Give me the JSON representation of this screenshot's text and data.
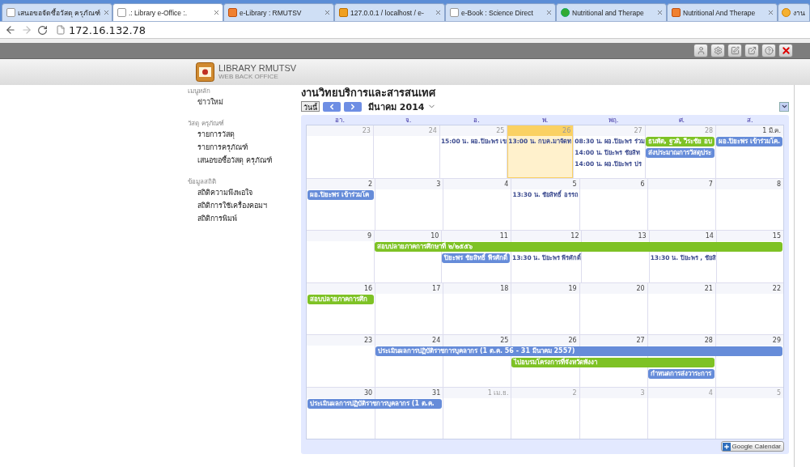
{
  "browser_tabs": [
    {
      "title": "เสนอขอจัดซื้อวัสดุ ครุภัณฑ์",
      "selected": false,
      "kind": "page"
    },
    {
      "title": ".: Library e-Office :.",
      "selected": true,
      "kind": "page"
    },
    {
      "title": "e-Library : RMUTSV",
      "selected": false,
      "kind": "orange"
    },
    {
      "title": "127.0.0.1 / localhost / e-",
      "selected": false,
      "kind": "pma"
    },
    {
      "title": "e-Book : Science Direct",
      "selected": false,
      "kind": "page"
    },
    {
      "title": "Nutritional and Therape",
      "selected": false,
      "kind": "green"
    },
    {
      "title": "Nutritional And Therape",
      "selected": false,
      "kind": "orange"
    },
    {
      "title": "งาน",
      "selected": false,
      "kind": "yellow"
    }
  ],
  "address_bar": {
    "url": "172.16.132.78"
  },
  "logo": {
    "title": "LIBRARY RMUTSV",
    "subtitle": "WEB BACK OFFICE"
  },
  "sidebar": [
    {
      "heading": "เมนูหลัก",
      "items": [
        "ข่าวใหม่"
      ]
    },
    {
      "heading": "วัสดุ ครุภัณฑ์",
      "items": [
        "รายการวัสดุ",
        "รายการครุภัณฑ์",
        "เสนอขอซื้อวัสดุ ครุภัณฑ์"
      ]
    },
    {
      "heading": "ข้อมูลสถิติ",
      "items": [
        "สถิติความพึงพอใจ",
        "สถิติการใช้เครื่องคอมฯ",
        "สถิติการพิมพ์"
      ]
    }
  ],
  "calendar": {
    "title": "งานวิทยบริการและสารสนเทศ",
    "today_button": "วันนี้",
    "month": "มีนาคม 2014",
    "weekdays": [
      "อา.",
      "จ.",
      "อ.",
      "พ.",
      "พฤ.",
      "ศ.",
      "ส."
    ],
    "weeks": [
      {
        "days": [
          {
            "label": "23",
            "other_month": true,
            "today": false
          },
          {
            "label": "24",
            "other_month": true,
            "today": false
          },
          {
            "label": "25",
            "other_month": true,
            "today": false
          },
          {
            "label": "26",
            "other_month": true,
            "today": true
          },
          {
            "label": "27",
            "other_month": true,
            "today": false
          },
          {
            "label": "28",
            "other_month": true,
            "today": false
          },
          {
            "label": "1 มี.ค.",
            "other_month": false,
            "today": false
          }
        ],
        "lanes": [
          [
            {
              "kind": "empty"
            },
            {
              "kind": "empty"
            },
            {
              "kind": "timed",
              "text": "15:00 น. ผอ.ปิยะพร เข"
            },
            {
              "kind": "timed",
              "text": "13:00 น. กบค.มาจัดท"
            },
            {
              "kind": "timed",
              "text": "08:30 น. ผอ.ปิยะพร ร่วม"
            },
            {
              "kind": "bar",
              "text": "ธนพัต, ฐวดิ, วีระชัย อบ",
              "color": "#7ec225"
            },
            {
              "kind": "bar",
              "text": "ผอ.ปิยะพร เข้าร่วมโค.",
              "color": "#668cd9"
            }
          ],
          [
            {
              "kind": "empty"
            },
            {
              "kind": "empty"
            },
            {
              "kind": "empty"
            },
            {
              "kind": "empty"
            },
            {
              "kind": "timed",
              "text": "14:00 น. ปิยะพร ชัยสิท"
            },
            {
              "kind": "bar",
              "text": "ส่งประมาณการวัสดุประ",
              "color": "#668cd9"
            },
            {
              "kind": "empty"
            }
          ],
          [
            {
              "kind": "empty"
            },
            {
              "kind": "empty"
            },
            {
              "kind": "empty"
            },
            {
              "kind": "empty"
            },
            {
              "kind": "timed",
              "text": "14:00 น. ผอ.ปิยะพร ปร"
            },
            {
              "kind": "empty"
            },
            {
              "kind": "empty"
            }
          ]
        ]
      },
      {
        "days": [
          {
            "label": "2",
            "other_month": false,
            "today": false
          },
          {
            "label": "3",
            "other_month": false,
            "today": false
          },
          {
            "label": "4",
            "other_month": false,
            "today": false
          },
          {
            "label": "5",
            "other_month": false,
            "today": false
          },
          {
            "label": "6",
            "other_month": false,
            "today": false
          },
          {
            "label": "7",
            "other_month": false,
            "today": false
          },
          {
            "label": "8",
            "other_month": false,
            "today": false
          }
        ],
        "lanes": [
          [
            {
              "kind": "bar",
              "text": "ผอ.ปิยะพร เข้าร่วมโค",
              "color": "#668cd9"
            },
            {
              "kind": "empty"
            },
            {
              "kind": "empty"
            },
            {
              "kind": "timed",
              "text": "13:30 น. ชัยสิทธิ์ อรรถ"
            },
            {
              "kind": "empty"
            },
            {
              "kind": "empty"
            },
            {
              "kind": "empty"
            }
          ]
        ]
      },
      {
        "days": [
          {
            "label": "9",
            "other_month": false,
            "today": false
          },
          {
            "label": "10",
            "other_month": false,
            "today": false
          },
          {
            "label": "11",
            "other_month": false,
            "today": false
          },
          {
            "label": "12",
            "other_month": false,
            "today": false
          },
          {
            "label": "13",
            "other_month": false,
            "today": false
          },
          {
            "label": "14",
            "other_month": false,
            "today": false
          },
          {
            "label": "15",
            "other_month": false,
            "today": false
          }
        ],
        "lanes": [
          [
            {
              "kind": "empty"
            },
            {
              "kind": "bar",
              "text": "สอบปลายภาคการศึกษาที่ ๒/๒๕๕๖",
              "color": "#7ec225"
            },
            {
              "kind": "continue"
            },
            {
              "kind": "continue"
            },
            {
              "kind": "continue"
            },
            {
              "kind": "continue"
            },
            {
              "kind": "continue"
            }
          ],
          [
            {
              "kind": "empty"
            },
            {
              "kind": "empty"
            },
            {
              "kind": "bar",
              "text": "ปิยะพร ชัยสิทธิ์ พีรศักดิ์",
              "color": "#668cd9"
            },
            {
              "kind": "timed",
              "text": "13:30 น. ปิยะพร พีรศักดิ์"
            },
            {
              "kind": "empty"
            },
            {
              "kind": "timed",
              "text": "13:30 น. ปิยะพร , ชัยสิ"
            },
            {
              "kind": "empty"
            }
          ]
        ]
      },
      {
        "days": [
          {
            "label": "16",
            "other_month": false,
            "today": false
          },
          {
            "label": "17",
            "other_month": false,
            "today": false
          },
          {
            "label": "18",
            "other_month": false,
            "today": false
          },
          {
            "label": "19",
            "other_month": false,
            "today": false
          },
          {
            "label": "20",
            "other_month": false,
            "today": false
          },
          {
            "label": "21",
            "other_month": false,
            "today": false
          },
          {
            "label": "22",
            "other_month": false,
            "today": false
          }
        ],
        "lanes": [
          [
            {
              "kind": "bar",
              "text": "สอบปลายภาคการศึก",
              "color": "#7ec225"
            },
            {
              "kind": "empty"
            },
            {
              "kind": "empty"
            },
            {
              "kind": "empty"
            },
            {
              "kind": "empty"
            },
            {
              "kind": "empty"
            },
            {
              "kind": "empty"
            }
          ]
        ]
      },
      {
        "days": [
          {
            "label": "23",
            "other_month": false,
            "today": false
          },
          {
            "label": "24",
            "other_month": false,
            "today": false
          },
          {
            "label": "25",
            "other_month": false,
            "today": false
          },
          {
            "label": "26",
            "other_month": false,
            "today": false
          },
          {
            "label": "27",
            "other_month": false,
            "today": false
          },
          {
            "label": "28",
            "other_month": false,
            "today": false
          },
          {
            "label": "29",
            "other_month": false,
            "today": false
          }
        ],
        "lanes": [
          [
            {
              "kind": "empty"
            },
            {
              "kind": "bar",
              "text": "ประเมินผลการปฏิบัติราชการบุคลากร (1 ต.ค. 56 - 31 มีนาคม 2557)",
              "color": "#668cd9"
            },
            {
              "kind": "continue"
            },
            {
              "kind": "continue"
            },
            {
              "kind": "continue"
            },
            {
              "kind": "continue"
            },
            {
              "kind": "continue"
            }
          ],
          [
            {
              "kind": "empty"
            },
            {
              "kind": "empty"
            },
            {
              "kind": "empty"
            },
            {
              "kind": "bar",
              "text": "ไปอบรมโครงการที่จังหวัดพังงา",
              "color": "#7ec225"
            },
            {
              "kind": "continue"
            },
            {
              "kind": "continue"
            },
            {
              "kind": "empty"
            }
          ],
          [
            {
              "kind": "empty"
            },
            {
              "kind": "empty"
            },
            {
              "kind": "empty"
            },
            {
              "kind": "empty"
            },
            {
              "kind": "empty"
            },
            {
              "kind": "bar",
              "text": "กำหนดการส่งวาระการ",
              "color": "#668cd9"
            },
            {
              "kind": "empty"
            }
          ]
        ]
      },
      {
        "days": [
          {
            "label": "30",
            "other_month": false,
            "today": false
          },
          {
            "label": "31",
            "other_month": false,
            "today": false
          },
          {
            "label": "1 เม.ย.",
            "other_month": true,
            "today": false
          },
          {
            "label": "2",
            "other_month": true,
            "today": false
          },
          {
            "label": "3",
            "other_month": true,
            "today": false
          },
          {
            "label": "4",
            "other_month": true,
            "today": false
          },
          {
            "label": "5",
            "other_month": true,
            "today": false
          }
        ],
        "lanes": [
          [
            {
              "kind": "bar",
              "text": "ประเมินผลการปฏิบัติราชการบุคลากร (1 ต.ค.",
              "color": "#668cd9"
            },
            {
              "kind": "continue"
            },
            {
              "kind": "empty"
            },
            {
              "kind": "empty"
            },
            {
              "kind": "empty"
            },
            {
              "kind": "empty"
            },
            {
              "kind": "empty"
            }
          ]
        ]
      }
    ],
    "footer_button": "Google Calendar"
  }
}
